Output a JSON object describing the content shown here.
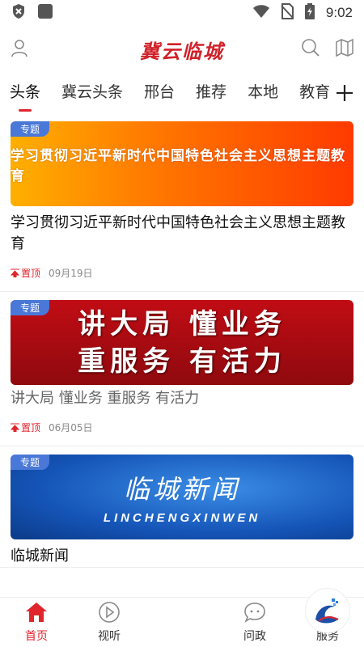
{
  "status": {
    "time": "9:02"
  },
  "header": {
    "logo": "冀云临城"
  },
  "tabs": [
    "头条",
    "冀云头条",
    "邢台",
    "推荐",
    "本地",
    "教育"
  ],
  "colors": {
    "accent": "#e0252d",
    "badge": "#4a78d8"
  },
  "cards": [
    {
      "badge": "专题",
      "banner_text": "学习贯彻习近平新时代中国特色社会主义思想主题教育",
      "title": "学习贯彻习近平新时代中国特色社会主义思想主题教育",
      "pin": "置顶",
      "date": "09月19日"
    },
    {
      "badge": "专题",
      "banner_line1": "讲大局 懂业务",
      "banner_line2": "重服务 有活力",
      "title": "讲大局 懂业务 重服务 有活力",
      "pin": "置顶",
      "date": "06月05日"
    },
    {
      "badge": "专题",
      "banner_title": "临城新闻",
      "banner_sub": "LINCHENGXINWEN",
      "title": "临城新闻"
    }
  ],
  "nav": {
    "home": "首页",
    "video": "视听",
    "politics": "问政",
    "service": "服务"
  },
  "icons": [
    "shield-icon",
    "square-icon",
    "wifi-icon",
    "no-sim-icon",
    "battery-icon",
    "user-icon",
    "search-icon",
    "map-icon",
    "plus-icon",
    "home-icon",
    "play-icon",
    "chat-icon",
    "heart-icon",
    "logo-wave-icon"
  ]
}
